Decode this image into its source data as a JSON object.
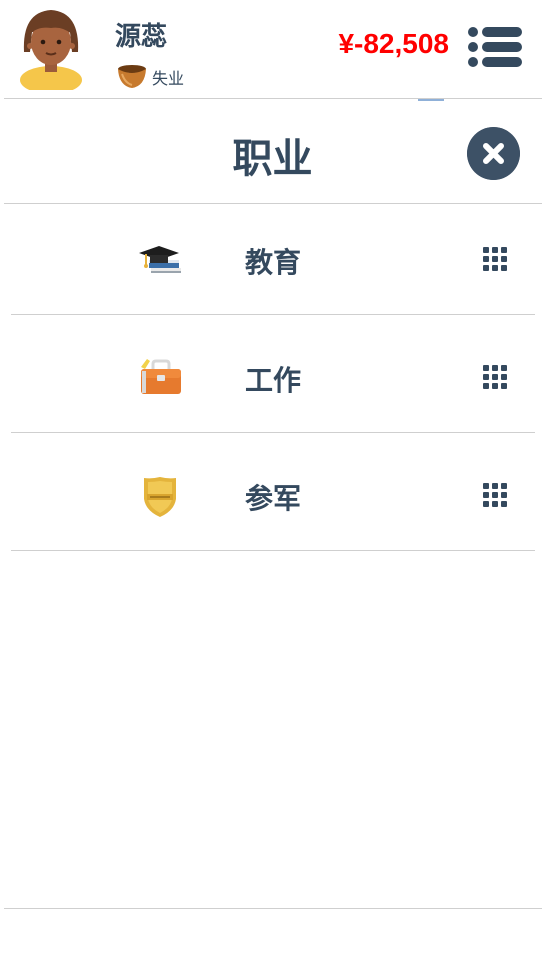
{
  "player": {
    "name": "源蕊",
    "status": "失业",
    "money": "¥-82,508",
    "avatar_icon": "woman-avatar-icon",
    "status_icon": "bowl-icon"
  },
  "header": {
    "menu_icon": "list-menu-icon"
  },
  "panel": {
    "title": "职业",
    "close_icon": "close-icon",
    "items": [
      {
        "label": "教育",
        "icon": "graduation-cap-icon",
        "action_icon": "grid-dots-icon"
      },
      {
        "label": "工作",
        "icon": "briefcase-icon",
        "action_icon": "grid-dots-icon"
      },
      {
        "label": "参军",
        "icon": "police-badge-icon",
        "action_icon": "grid-dots-icon"
      }
    ]
  },
  "colors": {
    "text": "#34495e",
    "money": "#ff0000",
    "close_bg": "#3d5166",
    "divider": "#cfcfcf"
  }
}
